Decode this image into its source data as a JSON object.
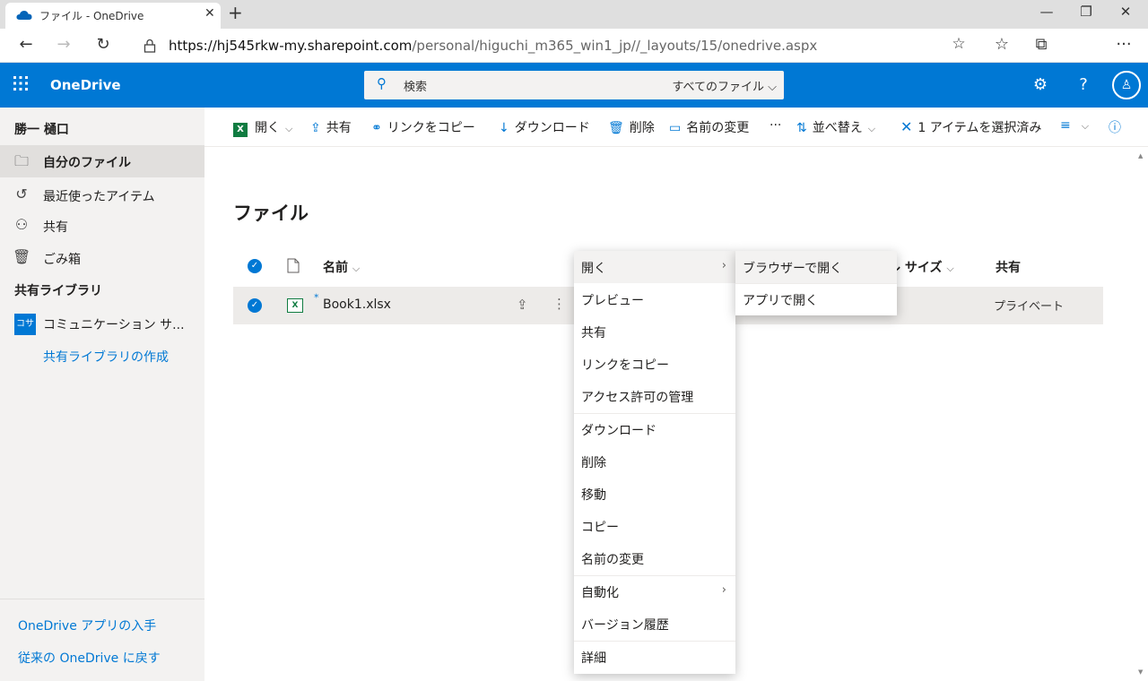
{
  "browser": {
    "tab_title": "ファイル - OneDrive",
    "url_host": "https://hj545rkw-my.sharepoint.com",
    "url_path": "/personal/higuchi_m365_win1_jp//_layouts/15/onedrive.aspx"
  },
  "suite": {
    "brand": "OneDrive",
    "search_placeholder": "検索",
    "search_scope": "すべてのファイル"
  },
  "sidebar": {
    "user": "勝一 樋口",
    "items": [
      {
        "label": "自分のファイル",
        "icon": "folder-icon"
      },
      {
        "label": "最近使ったアイテム",
        "icon": "history-icon"
      },
      {
        "label": "共有",
        "icon": "people-icon"
      },
      {
        "label": "ごみ箱",
        "icon": "trash-icon"
      }
    ],
    "library_section": "共有ライブラリ",
    "library_badge": "コサ",
    "library_name": "コミュニケーション サ...",
    "create_library": "共有ライブラリの作成",
    "get_app": "OneDrive アプリの入手",
    "classic": "従来の OneDrive に戻す"
  },
  "cmdbar": {
    "open": "開く",
    "share": "共有",
    "copy_link": "リンクをコピー",
    "download": "ダウンロード",
    "delete": "削除",
    "rename": "名前の変更",
    "more": "···",
    "sort": "並べ替え",
    "selected": "1 アイテムを選択済み",
    "excel_badge": "X"
  },
  "main": {
    "title": "ファイル",
    "col_name": "名前",
    "col_size": "ル サイズ",
    "col_shared": "共有",
    "file_name": "Book1.xlsx",
    "file_badge": "X",
    "file_shared": "プライベート"
  },
  "context_menu": {
    "items": [
      "開く",
      "プレビュー",
      "共有",
      "リンクをコピー",
      "アクセス許可の管理",
      "ダウンロード",
      "削除",
      "移動",
      "コピー",
      "名前の変更",
      "自動化",
      "バージョン履歴",
      "詳細"
    ]
  },
  "submenu": {
    "items": [
      "ブラウザーで開く",
      "アプリで開く"
    ]
  },
  "colors": {
    "brand_blue": "#0078d4",
    "excel_green": "#107c41"
  }
}
